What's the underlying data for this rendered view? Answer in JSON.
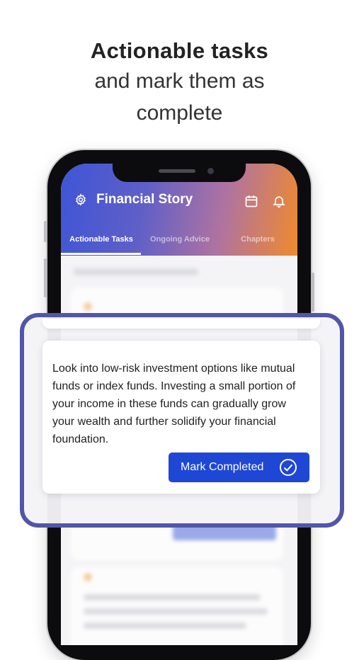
{
  "headline": {
    "bold": "Actionable  tasks",
    "line2": "and mark them as",
    "line3": "complete"
  },
  "app": {
    "title": "Financial Story",
    "icons": {
      "settings": "gear-icon",
      "calendar": "calendar-icon",
      "notifications": "bell-icon"
    }
  },
  "tabs": [
    {
      "label": "Actionable Tasks",
      "active": true
    },
    {
      "label": "Ongoing Advice",
      "active": false
    },
    {
      "label": "Chapters",
      "active": false
    }
  ],
  "task_card": {
    "text": "Look into low-risk investment options like mutual funds or index funds. Investing a small portion of your income in these funds can gradually grow your wealth and further solidify your financial foundation.",
    "button_label": "Mark Completed",
    "button_icon": "check-circle-icon"
  },
  "colors": {
    "header_start": "#3f55d6",
    "header_end": "#f08a2c",
    "frame": "#5256a8",
    "button": "#1f47d6"
  }
}
